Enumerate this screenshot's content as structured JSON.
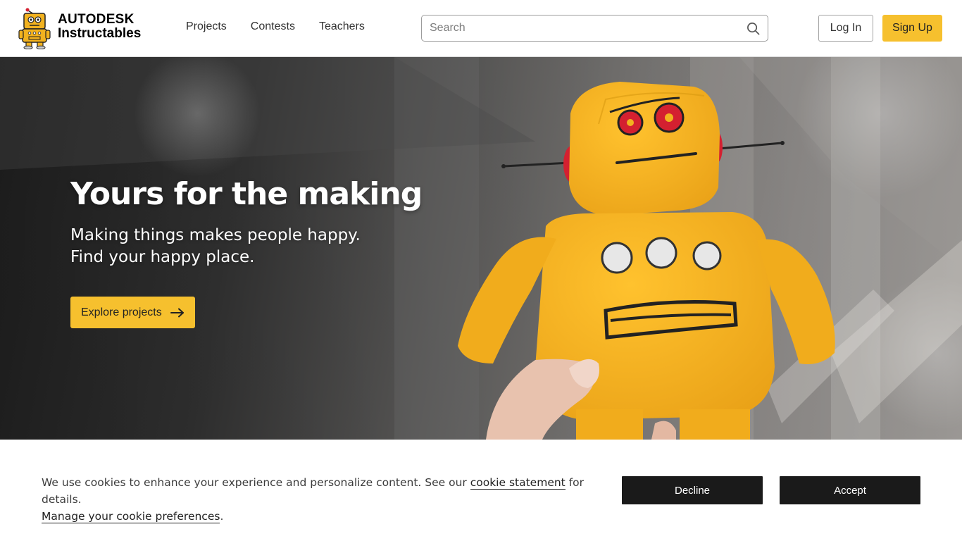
{
  "header": {
    "logo": {
      "brand": "AUTODESK",
      "product": "Instructables"
    },
    "nav": [
      {
        "label": "Projects"
      },
      {
        "label": "Contests"
      },
      {
        "label": "Teachers"
      }
    ],
    "search": {
      "placeholder": "Search",
      "value": ""
    },
    "login_label": "Log In",
    "signup_label": "Sign Up"
  },
  "hero": {
    "title": "Yours for the making",
    "subtitle": "Making things makes people happy. Find your happy place.",
    "cta_label": "Explore projects"
  },
  "cookie_banner": {
    "text_before": "We use cookies to enhance your experience and personalize content. See our ",
    "link_label": "cookie statement",
    "text_after": " for details.",
    "manage_label": "Manage your cookie preferences",
    "manage_after": ".",
    "decline_label": "Decline",
    "accept_label": "Accept"
  },
  "colors": {
    "accent": "#f6c02e",
    "dark_button": "#1a1a1a",
    "robot_yellow": "#f2b21f",
    "robot_red": "#d42030"
  },
  "icons": {
    "logo": "instructables-robot-icon",
    "search": "search-icon",
    "cta": "arrow-right-icon"
  }
}
